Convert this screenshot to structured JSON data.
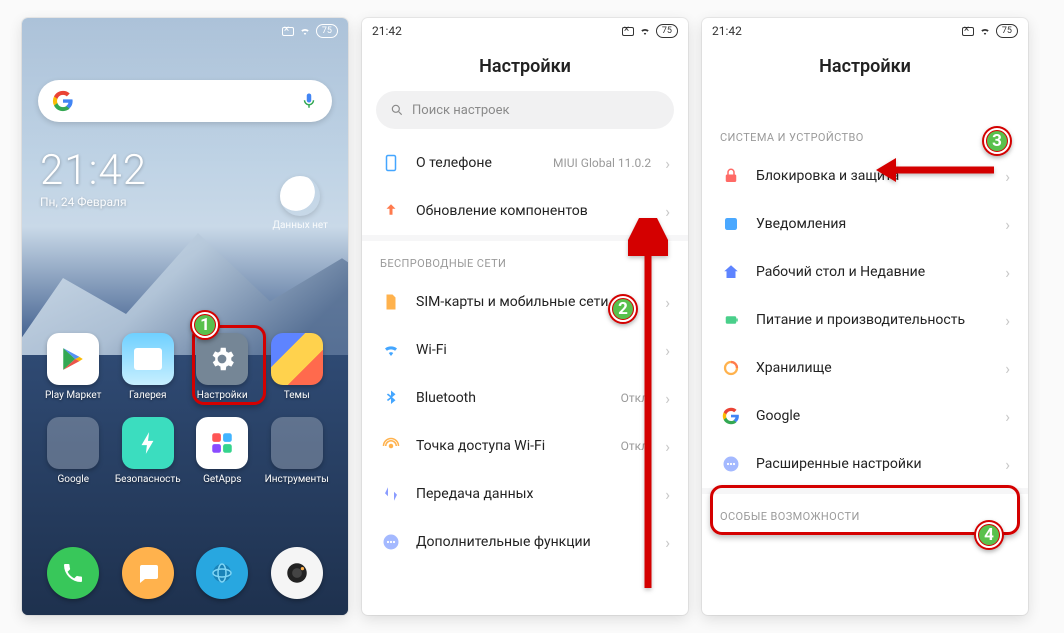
{
  "status": {
    "time": "21:42",
    "battery": "75"
  },
  "home": {
    "clock_time": "21:42",
    "clock_date": "Пн, 24 Февраля",
    "weather_label": "Данных нет",
    "apps": {
      "play": "Play Маркет",
      "gallery": "Галерея",
      "settings": "Настройки",
      "themes": "Темы",
      "google_folder": "Google",
      "security": "Безопасность",
      "getapps": "GetApps",
      "tools": "Инструменты"
    }
  },
  "screen2": {
    "title": "Настройки",
    "search_placeholder": "Поиск настроек",
    "about_label": "О телефоне",
    "about_value": "MIUI Global 11.0.2",
    "update_label": "Обновление компонентов",
    "section_wireless": "БЕСПРОВОДНЫЕ СЕТИ",
    "rows": {
      "sim": "SIM-карты и мобильные сети",
      "wifi": "Wi-Fi",
      "bluetooth": "Bluetooth",
      "hotspot": "Точка доступа Wi-Fi",
      "data": "Передача данных",
      "more": "Дополнительные функции"
    },
    "wifi_value": " ",
    "bt_value": "Откл.",
    "hotspot_value": "Откл."
  },
  "screen3": {
    "title": "Настройки",
    "section_system": "СИСТЕМА И УСТРОЙСТВО",
    "rows": {
      "lock": "Блокировка и защита",
      "notif": "Уведомления",
      "home": "Рабочий стол и Недавние",
      "power": "Питание и производительность",
      "storage": "Хранилище",
      "google": "Google",
      "advanced": "Расширенные настройки"
    },
    "section_special": "ОСОБЫЕ ВОЗМОЖНОСТИ"
  },
  "badges": {
    "b1": "1",
    "b2": "2",
    "b3": "3",
    "b4": "4"
  }
}
